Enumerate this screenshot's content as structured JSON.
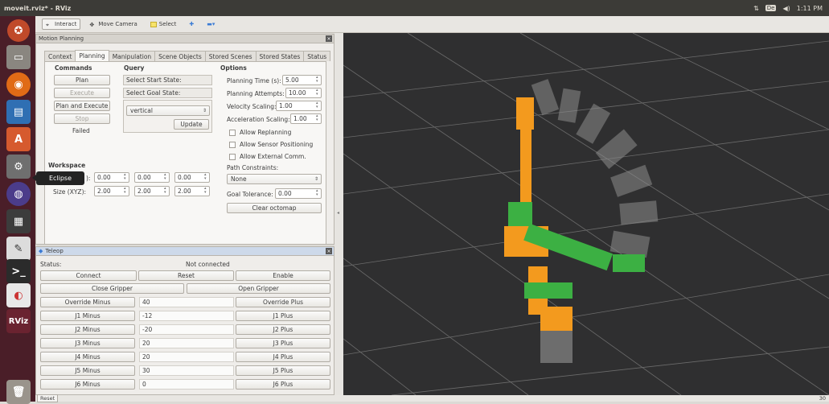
{
  "window": {
    "title": "moveit.rviz* - RViz"
  },
  "system_tray": {
    "keyboard": "De",
    "time": "1:11 PM"
  },
  "launcher": {
    "tooltip": "Eclipse",
    "rviz_label": "RViz"
  },
  "toolbar": {
    "interact": "Interact",
    "move_camera": "Move Camera",
    "select": "Select"
  },
  "motion_planning": {
    "title": "Motion Planning",
    "tabs": [
      "Context",
      "Planning",
      "Manipulation",
      "Scene Objects",
      "Stored Scenes",
      "Stored States",
      "Status"
    ],
    "commands": {
      "header": "Commands",
      "plan": "Plan",
      "execute": "Execute",
      "plan_execute": "Plan and Execute",
      "stop": "Stop",
      "status": "Failed"
    },
    "query": {
      "header": "Query",
      "start_state": "Select Start State:",
      "goal_state": "Select Goal State:",
      "goal_value": "vertical",
      "update": "Update"
    },
    "options": {
      "header": "Options",
      "planning_time_label": "Planning Time (s):",
      "planning_time": "5.00",
      "planning_attempts_label": "Planning Attempts:",
      "planning_attempts": "10.00",
      "velocity_label": "Velocity Scaling:",
      "velocity": "1.00",
      "accel_label": "Acceleration Scaling:",
      "accel": "1.00",
      "allow_replanning": "Allow Replanning",
      "allow_sensor": "Allow Sensor Positioning",
      "allow_external": "Allow External Comm.",
      "path_constraints_label": "Path Constraints:",
      "path_constraints": "None",
      "goal_tolerance_label": "Goal Tolerance:",
      "goal_tolerance": "0.00",
      "clear_octomap": "Clear octomap"
    },
    "workspace": {
      "header": "Workspace",
      "center_label": "):",
      "center": [
        "0.00",
        "0.00",
        "0.00"
      ],
      "size_label": "Size (XYZ):",
      "size": [
        "2.00",
        "2.00",
        "2.00"
      ]
    }
  },
  "teleop": {
    "title": "Teleop",
    "status_label": "Status:",
    "status_value": "Not connected",
    "connect": "Connect",
    "reset": "Reset",
    "enable": "Enable",
    "close_gripper": "Close Gripper",
    "open_gripper": "Open Gripper",
    "rows": [
      {
        "minus": "Override Minus",
        "value": "40",
        "plus": "Override Plus"
      },
      {
        "minus": "J1 Minus",
        "value": "-12",
        "plus": "J1 Plus"
      },
      {
        "minus": "J2 Minus",
        "value": "-20",
        "plus": "J2 Plus"
      },
      {
        "minus": "J3 Minus",
        "value": "20",
        "plus": "J3 Plus"
      },
      {
        "minus": "J4 Minus",
        "value": "20",
        "plus": "J4 Plus"
      },
      {
        "minus": "J5 Minus",
        "value": "30",
        "plus": "J5 Plus"
      },
      {
        "minus": "J6 Minus",
        "value": "0",
        "plus": "J6 Plus"
      }
    ]
  },
  "statusbar": {
    "reset": "Reset",
    "fps": "30"
  },
  "colors": {
    "robot_orange": "#f39a1e",
    "robot_green": "#3cb043",
    "viewport_bg": "#2f2f30",
    "launcher_bg": "#4a1e28"
  }
}
